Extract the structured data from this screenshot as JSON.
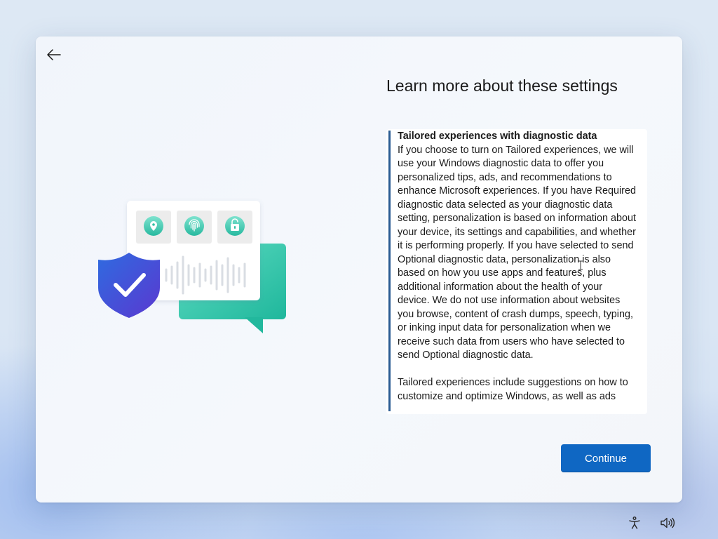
{
  "page": {
    "title": "Learn more about these settings"
  },
  "info": {
    "heading": "Tailored experiences with diagnostic data",
    "paragraph1": "If you choose to turn on Tailored experiences, we will use your Windows diagnostic data to offer you personalized tips, ads, and recommendations to enhance Microsoft experiences. If you have Required diagnostic data selected as your diagnostic data setting, personalization is based on information about your device, its settings and capabilities, and whether it is performing properly. If you have selected to send Optional diagnostic data, personalization is also based on how you use apps and features, plus additional information about the health of your device. We do not use information about websites you browse, content of crash dumps, speech, typing, or inking input data for personalization when we receive such data from users who have selected to send Optional diagnostic data.",
    "paragraph2": "Tailored experiences include suggestions on how to customize and optimize Windows, as well as ads"
  },
  "buttons": {
    "continue_label": "Continue"
  },
  "icons": {
    "back": "back-arrow-icon",
    "accessibility": "accessibility-icon",
    "volume": "volume-icon",
    "illustration": [
      "shield-check-icon",
      "location-pin-icon",
      "fingerprint-icon",
      "unlock-icon",
      "chat-bubble-icon",
      "voice-wave-icon"
    ]
  },
  "colors": {
    "accent": "#0f67c3",
    "scroll_accent": "#2a5c93",
    "shield": "#3a56d8",
    "teal": "#2ec4a8"
  }
}
